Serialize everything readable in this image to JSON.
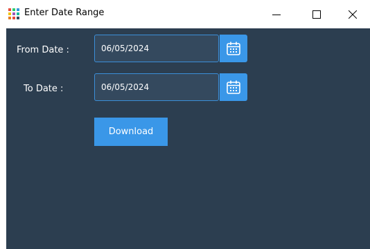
{
  "window": {
    "title": "Enter Date Range",
    "icon": "app-dots-icon",
    "controls": [
      "minimize-icon",
      "maximize-icon",
      "close-icon"
    ]
  },
  "form": {
    "from_label": "From Date :",
    "from_value": "06/05/2024",
    "to_label": "To Date :",
    "to_value": "06/05/2024",
    "calendar_icon": "calendar-icon",
    "download_label": "Download"
  },
  "colors": {
    "background": "#2c3e50",
    "input_background": "#34495e",
    "accent": "#3a97e8",
    "text": "#ffffff"
  }
}
